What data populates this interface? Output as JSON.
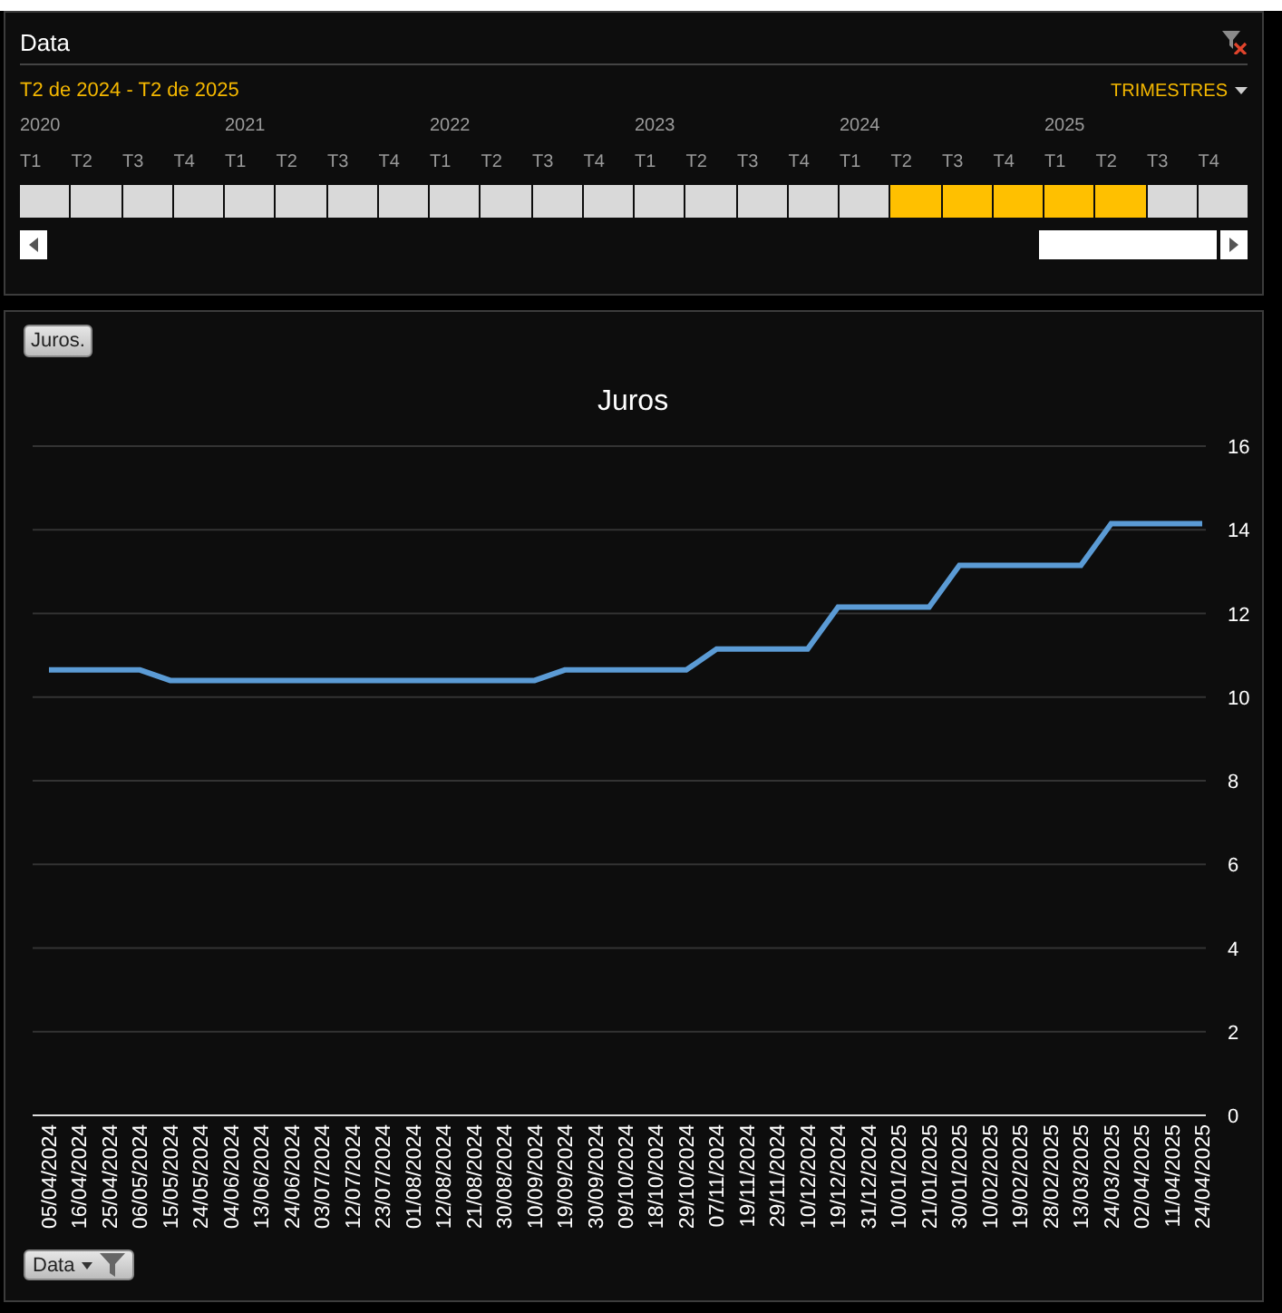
{
  "filter_panel": {
    "title": "Data",
    "range_label": "T2 de 2024 - T2 de 2025",
    "level_menu": "TRIMESTRES",
    "years": [
      "2020",
      "2021",
      "2022",
      "2023",
      "2024",
      "2025"
    ],
    "periods": [
      {
        "label": "T1",
        "selected": false
      },
      {
        "label": "T2",
        "selected": false
      },
      {
        "label": "T3",
        "selected": false
      },
      {
        "label": "T4",
        "selected": false
      },
      {
        "label": "T1",
        "selected": false
      },
      {
        "label": "T2",
        "selected": false
      },
      {
        "label": "T3",
        "selected": false
      },
      {
        "label": "T4",
        "selected": false
      },
      {
        "label": "T1",
        "selected": false
      },
      {
        "label": "T2",
        "selected": false
      },
      {
        "label": "T3",
        "selected": false
      },
      {
        "label": "T4",
        "selected": false
      },
      {
        "label": "T1",
        "selected": false
      },
      {
        "label": "T2",
        "selected": false
      },
      {
        "label": "T3",
        "selected": false
      },
      {
        "label": "T4",
        "selected": false
      },
      {
        "label": "T1",
        "selected": false
      },
      {
        "label": "T2",
        "selected": true
      },
      {
        "label": "T3",
        "selected": true
      },
      {
        "label": "T4",
        "selected": true
      },
      {
        "label": "T1",
        "selected": true
      },
      {
        "label": "T2",
        "selected": true
      },
      {
        "label": "T3",
        "selected": false
      },
      {
        "label": "T4",
        "selected": false
      }
    ]
  },
  "chart_panel": {
    "field_button": "Juros.",
    "axis_button": "Data",
    "chart_data": {
      "type": "line",
      "title": "Juros",
      "categories": [
        "05/04/2024",
        "16/04/2024",
        "25/04/2024",
        "06/05/2024",
        "15/05/2024",
        "24/05/2024",
        "04/06/2024",
        "13/06/2024",
        "24/06/2024",
        "03/07/2024",
        "12/07/2024",
        "23/07/2024",
        "01/08/2024",
        "12/08/2024",
        "21/08/2024",
        "30/08/2024",
        "10/09/2024",
        "19/09/2024",
        "30/09/2024",
        "09/10/2024",
        "18/10/2024",
        "29/10/2024",
        "07/11/2024",
        "19/11/2024",
        "29/11/2024",
        "10/12/2024",
        "19/12/2024",
        "31/12/2024",
        "10/01/2025",
        "21/01/2025",
        "30/01/2025",
        "10/02/2025",
        "19/02/2025",
        "28/02/2025",
        "13/03/2025",
        "24/03/2025",
        "02/04/2025",
        "11/04/2025",
        "24/04/2025"
      ],
      "series": [
        {
          "color": "#5b9bd5",
          "values": [
            10.65,
            10.65,
            10.65,
            10.65,
            10.4,
            10.4,
            10.4,
            10.4,
            10.4,
            10.4,
            10.4,
            10.4,
            10.4,
            10.4,
            10.4,
            10.4,
            10.4,
            10.65,
            10.65,
            10.65,
            10.65,
            10.65,
            11.15,
            11.15,
            11.15,
            11.15,
            12.15,
            12.15,
            12.15,
            12.15,
            13.15,
            13.15,
            13.15,
            13.15,
            13.15,
            14.15,
            14.15,
            14.15,
            14.15
          ]
        }
      ],
      "grid": true,
      "ylim": [
        0,
        16
      ],
      "yticks": [
        0,
        2,
        4,
        6,
        8,
        10,
        12,
        14,
        16
      ]
    }
  }
}
